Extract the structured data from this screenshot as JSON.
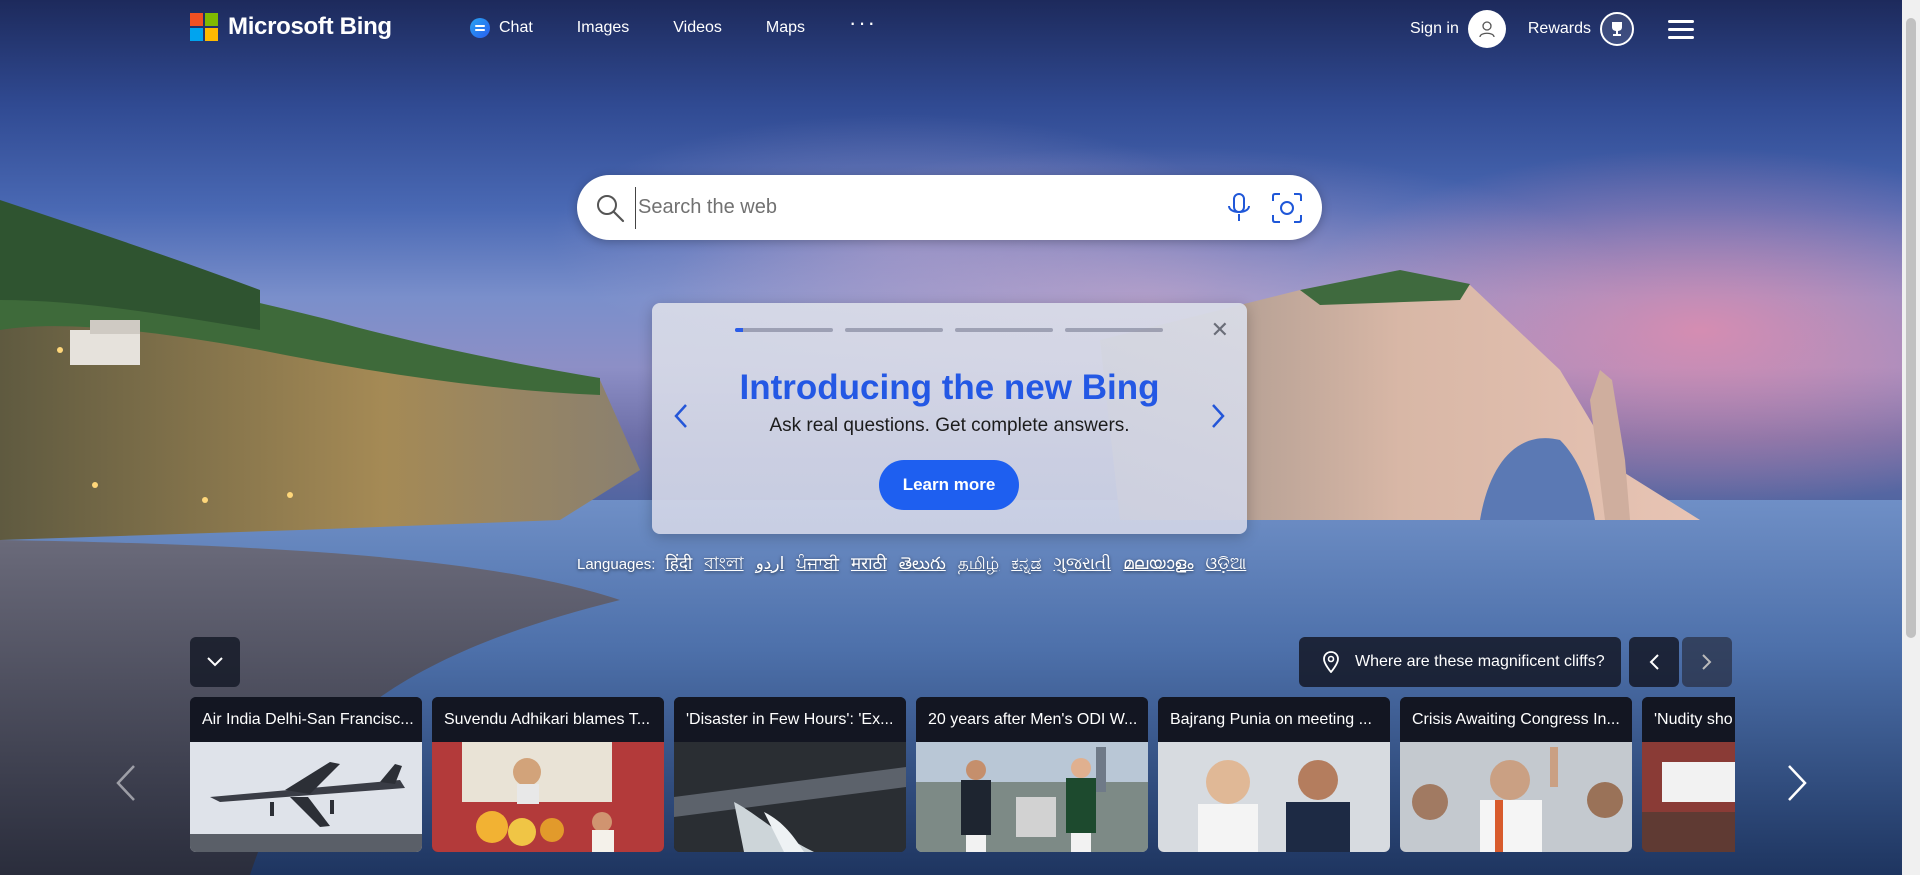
{
  "header": {
    "brand": "Microsoft Bing",
    "nav": [
      {
        "label": "Chat",
        "icon": "chat-icon"
      },
      {
        "label": "Images"
      },
      {
        "label": "Videos"
      },
      {
        "label": "Maps"
      }
    ],
    "more_label": "···",
    "sign_in": "Sign in",
    "rewards": "Rewards"
  },
  "search": {
    "placeholder": "Search the web",
    "value": ""
  },
  "promo": {
    "title": "Introducing the new Bing",
    "subtitle": "Ask real questions. Get complete answers.",
    "button": "Learn more",
    "progress": [
      0.08,
      0,
      0,
      0
    ]
  },
  "languages": {
    "label": "Languages:",
    "items": [
      "हिंदी",
      "বাংলা",
      "اردو",
      "ਪੰਜਾਬੀ",
      "मराठी",
      "తెలుగు",
      "தமிழ்",
      "ಕನ್ನಡ",
      "ગુજરાતી",
      "മലയാളം",
      "ଓଡ଼ିଆ"
    ]
  },
  "image_caption": "Where are these magnificent cliffs?",
  "news": [
    {
      "title": "Air India Delhi-San Francisc..."
    },
    {
      "title": "Suvendu Adhikari blames T..."
    },
    {
      "title": "'Disaster in Few Hours': 'Ex..."
    },
    {
      "title": "20 years after Men's ODI W..."
    },
    {
      "title": "Bajrang Punia on meeting ..."
    },
    {
      "title": "Crisis Awaiting Congress In..."
    },
    {
      "title": "'Nudity sho"
    }
  ],
  "colors": {
    "accent": "#2458e4",
    "button": "#1e5ff0"
  }
}
